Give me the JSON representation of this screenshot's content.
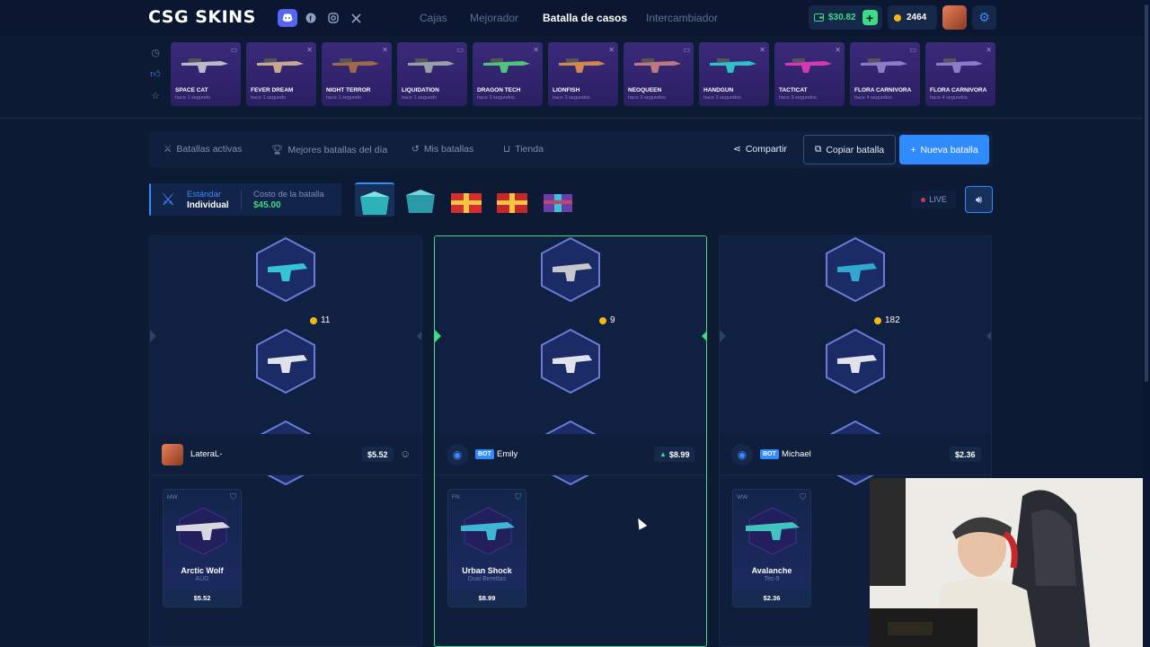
{
  "header": {
    "logo": "CSG SKINS",
    "nav": [
      "Cajas",
      "Mejorador",
      "Batalla de casos",
      "Intercambiador"
    ],
    "active_nav": "Batalla de casos",
    "balance": "$30.82",
    "coins": "2464",
    "social_icons": [
      "discord-icon",
      "facebook-icon",
      "instagram-icon",
      "x-icon"
    ]
  },
  "drops": [
    {
      "name": "SPACE CAT",
      "time": "hace 1 segundo"
    },
    {
      "name": "FEVER DREAM",
      "time": "hace 1 segundo"
    },
    {
      "name": "NIGHT TERROR",
      "time": "hace 1 segundo"
    },
    {
      "name": "LIQUIDATION",
      "time": "hace 1 segundo"
    },
    {
      "name": "DRAGON TECH",
      "time": "hace 3 segundos"
    },
    {
      "name": "LIONFISH",
      "time": "hace 3 segundos"
    },
    {
      "name": "NEOQUEEN",
      "time": "hace 3 segundos"
    },
    {
      "name": "HANDGUN",
      "time": "hace 3 segundos"
    },
    {
      "name": "TACTICAT",
      "time": "hace 3 segundos"
    },
    {
      "name": "FLORA CARNIVORA",
      "time": "hace 4 segundos"
    },
    {
      "name": "FLORA CARNIVORA",
      "time": "hace 4 segundos"
    }
  ],
  "tabs": {
    "active": "Batallas activas",
    "best": "Mejores batallas del día",
    "mine": "Mis batallas",
    "shop": "Tienda",
    "share": "Compartir",
    "copy": "Copiar batalla",
    "new": "Nueva batalla"
  },
  "mode": {
    "type": "Estándar",
    "sub": "Individual",
    "cost_label": "Costo de la batalla",
    "cost": "$45.00"
  },
  "live_label": "LIVE",
  "players": [
    {
      "name": "LateraL-",
      "amount": "$5.52",
      "tickets": "11",
      "is_bot": false,
      "item": {
        "cond": "MW",
        "name": "Arctic Wolf",
        "type": "AUG",
        "price": "$5.52"
      }
    },
    {
      "name": "Emily",
      "amount": "$8.99",
      "tickets": "9",
      "is_bot": true,
      "item": {
        "cond": "FN",
        "name": "Urban Shock",
        "type": "Dual Berettas",
        "price": "$8.99"
      }
    },
    {
      "name": "Michael",
      "amount": "$2.36",
      "tickets": "182",
      "is_bot": true,
      "item": {
        "cond": "WW",
        "name": "Avalanche",
        "type": "Tec-9",
        "price": "$2.36"
      }
    }
  ],
  "bot_tag": "BOT",
  "colors": {
    "accent": "#2f8bff",
    "money": "#3ddc84",
    "coin": "#f3b718",
    "drop_bg": "#2a1f63"
  }
}
